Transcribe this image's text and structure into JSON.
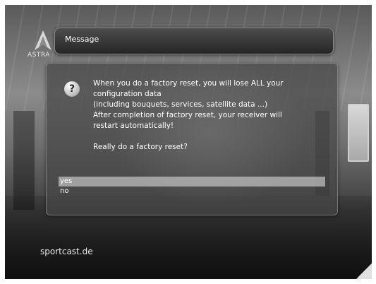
{
  "logo": {
    "brand_text": "ASTRA"
  },
  "dialog": {
    "title": "Message",
    "icon": "question-mark-icon",
    "message_lines": [
      "When you do a factory reset, you will lose ALL your",
      "configuration data",
      "(including bouquets, services, satellite data ...)",
      "After completion of factory reset, your receiver will",
      "restart automatically!"
    ],
    "question": "Really do a factory reset?",
    "options": [
      {
        "label": "yes",
        "selected": true
      },
      {
        "label": "no",
        "selected": false
      }
    ]
  },
  "footer": {
    "watermark": "sportcast.de"
  },
  "colors": {
    "highlight": "#bebebe",
    "text": "#ffffff",
    "panel": "#464646"
  }
}
